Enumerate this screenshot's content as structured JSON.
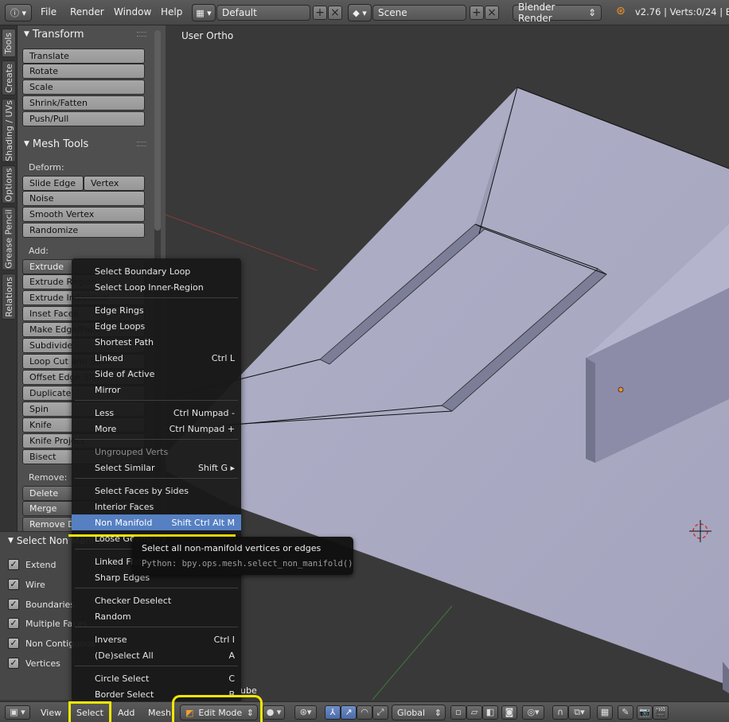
{
  "topbar": {
    "menus": [
      "File",
      "Render",
      "Window",
      "Help"
    ],
    "layout": "Default",
    "scene": "Scene",
    "engine": "Blender Render",
    "stats": "v2.76 | Verts:0/24 | Edg"
  },
  "viewport": {
    "label": "User Ortho",
    "object_label": "ube"
  },
  "tabs": [
    "Tools",
    "Create",
    "Shading / UVs",
    "Options",
    "Grease Pencil",
    "Relations"
  ],
  "shelf": {
    "transform_title": "Transform",
    "transform": [
      "Translate",
      "Rotate",
      "Scale",
      "Shrink/Fatten",
      "Push/Pull"
    ],
    "meshtools_title": "Mesh Tools",
    "deform_label": "Deform:",
    "slide_edge": "Slide Edge",
    "vertex": "Vertex",
    "deform": [
      "Noise",
      "Smooth Vertex",
      "Randomize"
    ],
    "add_label": "Add:",
    "add": [
      "Extrude",
      "Extrude Region",
      "Extrude Individual",
      "Inset Faces",
      "Make Edge/Face",
      "Subdivide",
      "Loop Cut and Slide",
      "Offset Edge Slide",
      "Duplicate",
      "Spin",
      "Knife",
      "Knife Project",
      "Bisect"
    ],
    "remove_label": "Remove:",
    "remove": [
      "Delete",
      "Merge",
      "Remove Doubles"
    ]
  },
  "redo": {
    "title": "Select Non Manifold",
    "options": [
      "Extend",
      "Wire",
      "Boundaries",
      "Multiple Faces",
      "Non Contiguous",
      "Vertices"
    ]
  },
  "menu": {
    "items": [
      {
        "label": "Select Boundary Loop",
        "shortcut": ""
      },
      {
        "label": "Select Loop Inner-Region",
        "shortcut": ""
      },
      {
        "label": "Edge Rings",
        "shortcut": ""
      },
      {
        "label": "Edge Loops",
        "shortcut": ""
      },
      {
        "label": "Shortest Path",
        "shortcut": ""
      },
      {
        "label": "Linked",
        "shortcut": "Ctrl L"
      },
      {
        "label": "Side of Active",
        "shortcut": ""
      },
      {
        "label": "Mirror",
        "shortcut": ""
      },
      {
        "label": "Less",
        "shortcut": "Ctrl Numpad -"
      },
      {
        "label": "More",
        "shortcut": "Ctrl Numpad +"
      },
      {
        "label": "Ungrouped Verts",
        "shortcut": ""
      },
      {
        "label": "Select Similar",
        "shortcut": "Shift G ▸"
      },
      {
        "label": "Select Faces by Sides",
        "shortcut": ""
      },
      {
        "label": "Interior Faces",
        "shortcut": ""
      },
      {
        "label": "Non Manifold",
        "shortcut": "Shift Ctrl Alt M"
      },
      {
        "label": "Loose Geometry",
        "shortcut": ""
      },
      {
        "label": "Linked Flat Faces",
        "shortcut": ""
      },
      {
        "label": "Sharp Edges",
        "shortcut": ""
      },
      {
        "label": "Checker Deselect",
        "shortcut": ""
      },
      {
        "label": "Random",
        "shortcut": ""
      },
      {
        "label": "Inverse",
        "shortcut": "Ctrl I"
      },
      {
        "label": "(De)select All",
        "shortcut": "A"
      },
      {
        "label": "Circle Select",
        "shortcut": "C"
      },
      {
        "label": "Border Select",
        "shortcut": "B"
      }
    ]
  },
  "tooltip": {
    "title": "Select all non-manifold vertices or edges",
    "python": "Python: bpy.ops.mesh.select_non_manifold()"
  },
  "bottombar": {
    "menus": [
      "View",
      "Select",
      "Add",
      "Mesh"
    ],
    "mode": "Edit Mode",
    "orientation": "Global"
  },
  "colors": {
    "highlight": "#5680c2",
    "annotation": "#f3e600",
    "mesh_top": "#a9a9c4"
  }
}
